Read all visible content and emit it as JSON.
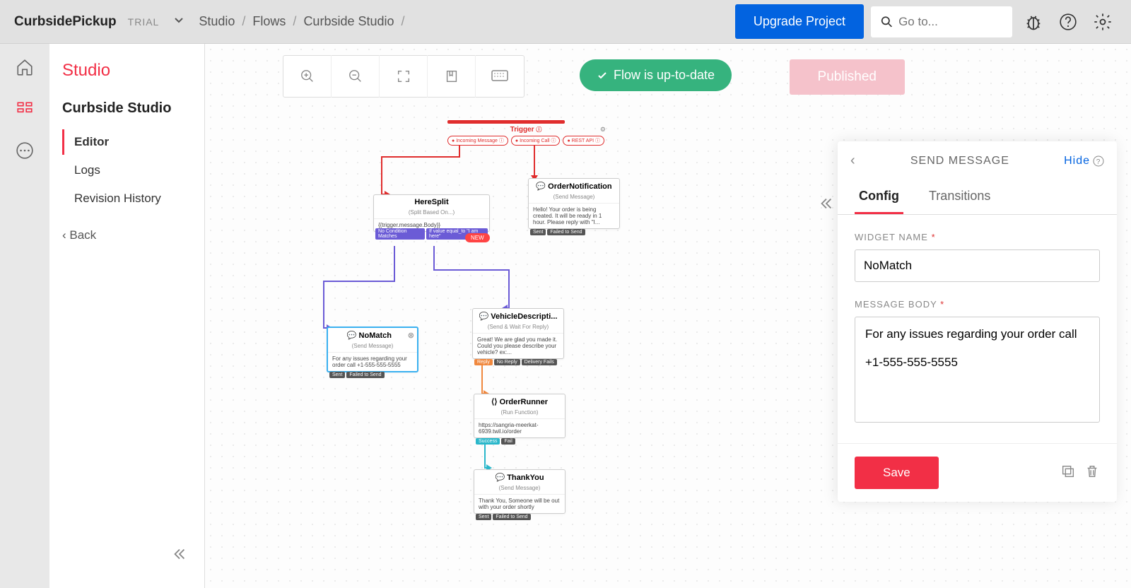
{
  "header": {
    "project_name": "CurbsidePickup",
    "trial_label": "TRIAL",
    "breadcrumbs": [
      "Studio",
      "Flows",
      "Curbside Studio"
    ],
    "upgrade_label": "Upgrade Project",
    "search_placeholder": "Go to..."
  },
  "sidebar": {
    "title": "Studio",
    "flow_name": "Curbside Studio",
    "items": [
      "Editor",
      "Logs",
      "Revision History"
    ],
    "back_label": "Back"
  },
  "toolbar": {
    "status_text": "Flow is up-to-date",
    "publish_label": "Published"
  },
  "trigger": {
    "label": "Trigger",
    "pills": [
      "Incoming Message",
      "Incoming Call",
      "REST API"
    ]
  },
  "widgets": {
    "heresplit": {
      "title": "HereSplit",
      "sub": "(Split Based On...)",
      "body": "{{trigger.message.Body}}",
      "tags": [
        "No Condition Matches",
        "If value equal_to \"I am here\""
      ],
      "new_label": "NEW"
    },
    "ordernotif": {
      "title": "OrderNotification",
      "sub": "(Send Message)",
      "body": "Hello! Your order is being created. It will be ready in 1 hour. Please reply with \"I...",
      "tags": [
        "Sent",
        "Failed to Send"
      ]
    },
    "nomatch": {
      "title": "NoMatch",
      "sub": "(Send Message)",
      "body": "For any issues regarding your order call +1-555-555-5555",
      "tags": [
        "Sent",
        "Failed to Send"
      ]
    },
    "vehicle": {
      "title": "VehicleDescripti...",
      "sub": "(Send & Wait For Reply)",
      "body": "Great! We are glad you made it. Could you please describe your vehicle? ex:...",
      "tags": [
        "Reply",
        "No Reply",
        "Delivery Fails"
      ]
    },
    "orderrunner": {
      "title": "OrderRunner",
      "sub": "(Run Function)",
      "body": "https://sangria-meerkat-6939.twil.io/order",
      "tags": [
        "Success",
        "Fail"
      ]
    },
    "thankyou": {
      "title": "ThankYou",
      "sub": "(Send Message)",
      "body": "Thank You, Someone will be out with your order shortly",
      "tags": [
        "Sent",
        "Failed to Send"
      ]
    }
  },
  "panel": {
    "title": "SEND MESSAGE",
    "hide_label": "Hide",
    "tabs": [
      "Config",
      "Transitions"
    ],
    "widget_name_label": "WIDGET NAME",
    "widget_name_value": "NoMatch",
    "message_body_label": "MESSAGE BODY",
    "message_body_value": "For any issues regarding your order call\n\n+1-555-555-5555",
    "save_label": "Save"
  }
}
